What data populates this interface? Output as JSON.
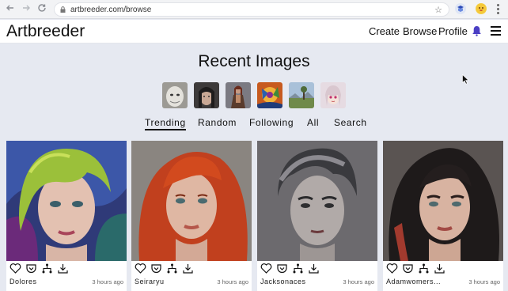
{
  "browser": {
    "url": "artbreeder.com/browse",
    "icons": [
      "back-arrow-icon",
      "forward-arrow-icon",
      "reload-icon",
      "lock-icon",
      "star-icon",
      "extension-icon",
      "profile-emoji-icon",
      "menu-dots-icon"
    ]
  },
  "header": {
    "logo": "Artbreeder",
    "nav": [
      "Create",
      "Browse",
      "Profile"
    ],
    "icons": [
      "bell-icon",
      "hamburger-menu-icon"
    ],
    "accent": "#4b3fc4"
  },
  "main": {
    "title": "Recent Images",
    "categories": [
      "portraits-category",
      "anime-portraits-category",
      "characters-category",
      "general-category",
      "landscapes-category",
      "anime-category"
    ],
    "tabs": [
      {
        "label": "Trending",
        "active": true
      },
      {
        "label": "Random",
        "active": false
      },
      {
        "label": "Following",
        "active": false
      },
      {
        "label": "All",
        "active": false
      },
      {
        "label": "Search",
        "active": false
      }
    ]
  },
  "cards": [
    {
      "artist": "Dolores",
      "time": "3 hours ago"
    },
    {
      "artist": "Seiraryu",
      "time": "3 hours ago"
    },
    {
      "artist": "Jacksonaces",
      "time": "3 hours ago"
    },
    {
      "artist": "Adamwomers...",
      "time": "3 hours ago"
    }
  ],
  "card_actions": [
    "heart-icon",
    "pocket-save-icon",
    "family-tree-icon",
    "download-icon"
  ]
}
